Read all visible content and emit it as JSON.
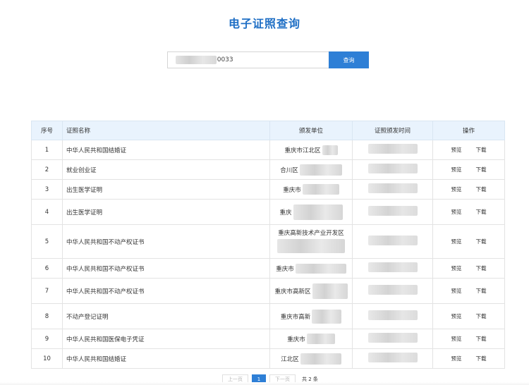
{
  "page": {
    "title": "电子证照查询"
  },
  "search": {
    "value": "60033",
    "button_label": "查询"
  },
  "table": {
    "headers": {
      "seq": "序号",
      "name": "证照名称",
      "unit": "颁发单位",
      "time": "证照颁发时间",
      "ops": "操作"
    },
    "rows": [
      {
        "seq": "1",
        "name": "中华人民共和国结婚证",
        "unit": "重庆市江北区",
        "preview": "预览",
        "download": "下载"
      },
      {
        "seq": "2",
        "name": "就业创业证",
        "unit": "合川区",
        "preview": "预览",
        "download": "下载"
      },
      {
        "seq": "3",
        "name": "出生医学证明",
        "unit": "重庆市",
        "preview": "预览",
        "download": "下载"
      },
      {
        "seq": "4",
        "name": "出生医学证明",
        "unit": "重庆",
        "preview": "预览",
        "download": "下载"
      },
      {
        "seq": "5",
        "name": "中华人民共和国不动产权证书",
        "unit": "重庆高新技术产业开发区",
        "preview": "预览",
        "download": "下载"
      },
      {
        "seq": "6",
        "name": "中华人民共和国不动产权证书",
        "unit": "重庆市",
        "preview": "预览",
        "download": "下载"
      },
      {
        "seq": "7",
        "name": "中华人民共和国不动产权证书",
        "unit": "重庆市高新区",
        "preview": "预览",
        "download": "下载"
      },
      {
        "seq": "8",
        "name": "不动产登记证明",
        "unit": "重庆市高新",
        "preview": "预览",
        "download": "下载"
      },
      {
        "seq": "9",
        "name": "中华人民共和国医保电子凭证",
        "unit": "重庆市",
        "preview": "预览",
        "download": "下载"
      },
      {
        "seq": "10",
        "name": "中华人民共和国结婚证",
        "unit": "江北区",
        "preview": "预览",
        "download": "下载"
      }
    ]
  },
  "pagination": {
    "prev": "上一页",
    "current": "1",
    "next": "下一页",
    "total": "共 2 条"
  },
  "colors": {
    "accent": "#2e7fd6",
    "title": "#1f6fc5",
    "header_bg": "#e9f3fd"
  }
}
